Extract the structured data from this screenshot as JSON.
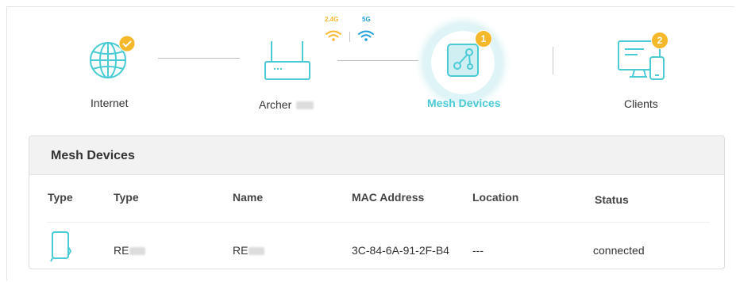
{
  "topology": {
    "internet": {
      "label": "Internet"
    },
    "router": {
      "label": "Archer",
      "band_24": "2.4G",
      "band_5": "5G"
    },
    "mesh": {
      "label": "Mesh Devices",
      "badge": "1"
    },
    "clients": {
      "label": "Clients",
      "badge": "2"
    }
  },
  "panel": {
    "title": "Mesh Devices",
    "columns": [
      "Type",
      "Type",
      "Name",
      "MAC Address",
      "Location",
      "Status"
    ],
    "rows": [
      {
        "type": "RE",
        "name": "RE",
        "mac": "3C-84-6A-91-2F-B4",
        "location": "---",
        "status": "connected"
      }
    ]
  },
  "colors": {
    "accent": "#4acbd6",
    "badge": "#f5b82a",
    "band_24": "#f5b82a",
    "band_5": "#1e9fd8"
  }
}
